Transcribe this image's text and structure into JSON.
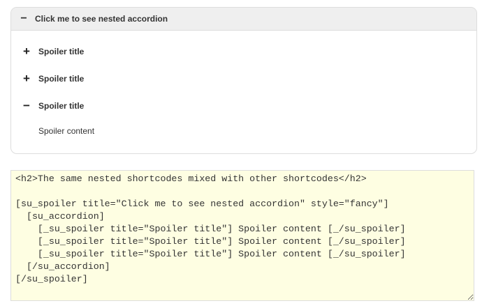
{
  "spoiler": {
    "title": "Click me to see nested accordion",
    "icon": "minus-icon",
    "items": [
      {
        "title": "Spoiler title",
        "icon": "plus-icon",
        "glyph": "+"
      },
      {
        "title": "Spoiler title",
        "icon": "plus-icon",
        "glyph": "+"
      },
      {
        "title": "Spoiler title",
        "icon": "minus-icon",
        "glyph": "−"
      }
    ],
    "open_content": "Spoiler content"
  },
  "code": {
    "value": "<h2>The same nested shortcodes mixed with other shortcodes</h2>\n\n[su_spoiler title=\"Click me to see nested accordion\" style=\"fancy\"]\n  [su_accordion]\n    [_su_spoiler title=\"Spoiler title\"] Spoiler content [_/su_spoiler]\n    [_su_spoiler title=\"Spoiler title\"] Spoiler content [_/su_spoiler]\n    [_su_spoiler title=\"Spoiler title\"] Spoiler content [_/su_spoiler]\n  [/su_accordion]\n[/su_spoiler]"
  }
}
